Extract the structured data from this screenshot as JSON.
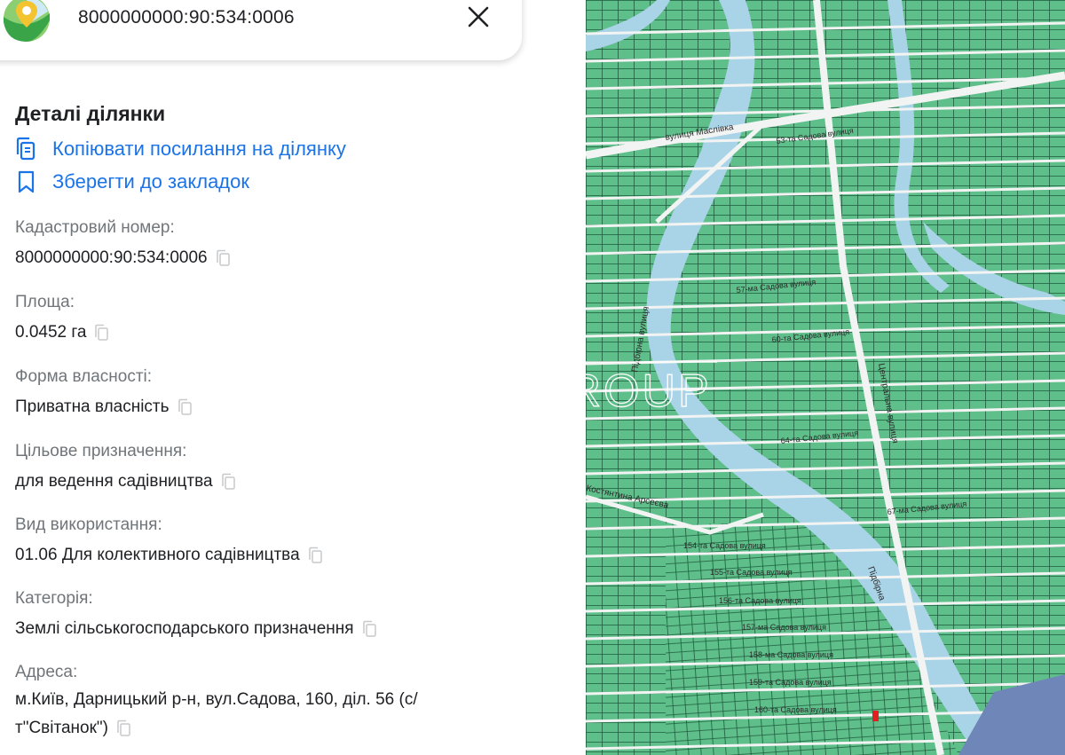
{
  "search": {
    "query": "8000000000:90:534:0006"
  },
  "details": {
    "title": "Деталі ділянки",
    "copy_link_label": "Копіювати посилання на ділянку",
    "bookmark_label": "Зберегти до закладок",
    "fields": [
      {
        "label": "Кадастровий номер:",
        "value": "8000000000:90:534:0006"
      },
      {
        "label": "Площа:",
        "value": "0.0452 га"
      },
      {
        "label": "Форма власності:",
        "value": "Приватна власність"
      },
      {
        "label": "Цільове призначення:",
        "value": "для ведення садівництва"
      },
      {
        "label": "Вид використання:",
        "value": "01.06 Для колективного садівництва"
      },
      {
        "label": "Категорія:",
        "value": "Землі сільськогосподарського призначення"
      },
      {
        "label": "Адреса:",
        "value_line1": "м.Київ, Дарницький р-н, вул.Садова, 160, діл. 56 (с/",
        "value_line2": "т\"Світанок\")"
      }
    ]
  },
  "map": {
    "labels": {
      "maslivka": "вулиця Маслівка",
      "pidbirna_st": "Підбірна вулиця",
      "pidbirna": "Підбірна",
      "tsentralna": "Центральна вулиця",
      "kostiantyna": "Костянтина Арсеєва",
      "s53": "53-та Садова вулиця",
      "s57": "57-ма Садова вулиця",
      "s60": "60-та Садова вулиця",
      "s64": "64-та Садова вулиця",
      "s67": "67-ма Садова вулиця",
      "s154": "154-та Садова вулиця",
      "s155": "155-та Садова вулиця",
      "s156": "156-та Садова вулиця",
      "s157": "157-ма Садова вулиця",
      "s158": "158-ма Садова вулиця",
      "s159": "159-та Садова вулиця",
      "s160": "160-та Садова вулиця"
    },
    "colors": {
      "parcel": "#5fbf8a",
      "parcel_line": "#1c5a3c",
      "street": "#f2f4f3",
      "river": "#a9d3e6",
      "selected": "#e02020",
      "urban": "#6f86b8"
    }
  },
  "watermark": "LEVEL GROUP",
  "colors": {
    "accent": "#1a73e8",
    "muted": "#70757a"
  }
}
